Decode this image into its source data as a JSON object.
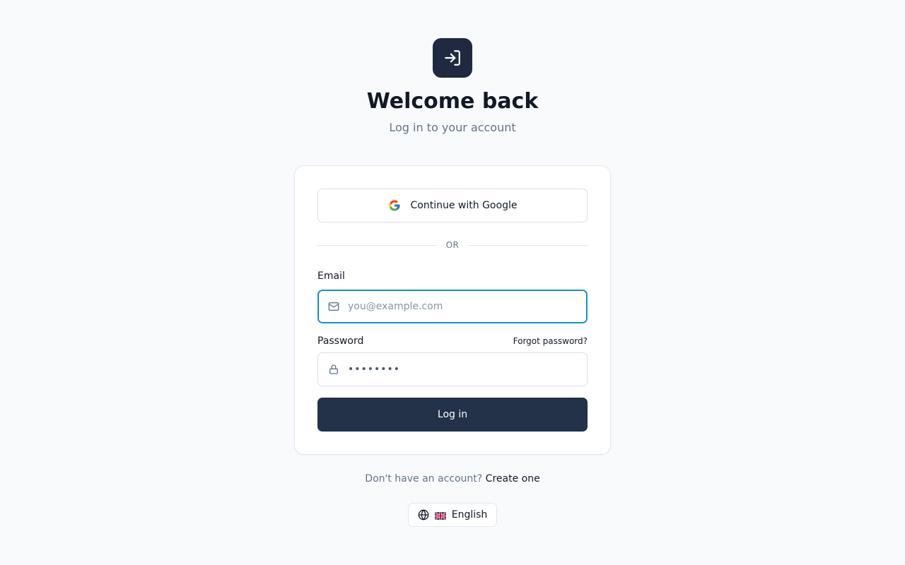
{
  "header": {
    "logo_icon": "login-arrow-icon",
    "title": "Welcome back",
    "subtitle": "Log in to your account"
  },
  "card": {
    "google_button": {
      "icon": "google-icon",
      "label": "Continue with Google"
    },
    "divider_text": "OR",
    "email": {
      "label": "Email",
      "icon": "mail-icon",
      "placeholder": "you@example.com",
      "value": ""
    },
    "password": {
      "label": "Password",
      "icon": "lock-icon",
      "forgot_link": "Forgot password?",
      "value": "password"
    },
    "login_button": "Log in"
  },
  "footer": {
    "signup_prompt": "Don't have an account?",
    "signup_link": "Create one",
    "language": {
      "globe_icon": "globe-icon",
      "flag_icon": "uk-flag-icon",
      "label": "English"
    }
  },
  "colors": {
    "primary_dark": "#1f2a40",
    "button_dark": "#233149",
    "focus_ring": "#0ea5e9",
    "background": "#f8fafc",
    "muted_text": "#64748b"
  }
}
